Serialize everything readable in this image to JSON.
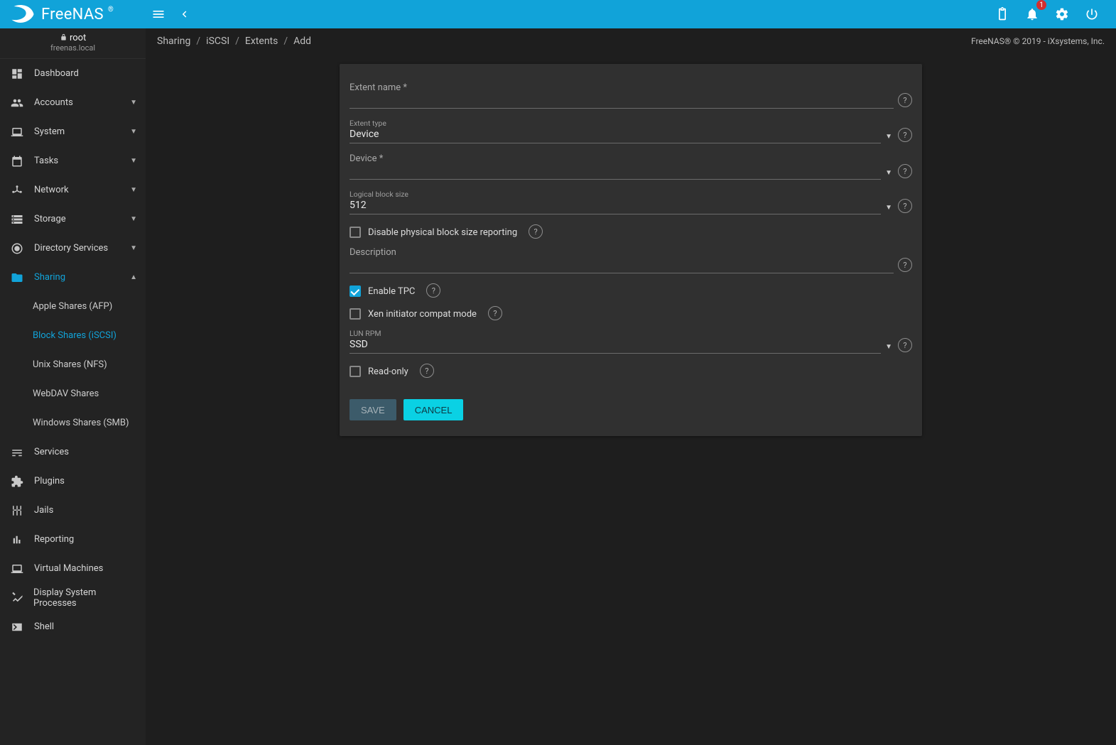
{
  "brand": {
    "name": "FreeNAS"
  },
  "user": {
    "name": "root",
    "host": "freenas.local"
  },
  "topbar": {
    "badge": "1"
  },
  "breadcrumb": [
    "Sharing",
    "iSCSI",
    "Extents",
    "Add"
  ],
  "copyright": "FreeNAS® © 2019 - iXsystems, Inc.",
  "sidebar": {
    "items": [
      {
        "label": "Dashboard",
        "icon": "dashboard",
        "expandable": false
      },
      {
        "label": "Accounts",
        "icon": "people",
        "expandable": true
      },
      {
        "label": "System",
        "icon": "laptop",
        "expandable": true
      },
      {
        "label": "Tasks",
        "icon": "calendar",
        "expandable": true
      },
      {
        "label": "Network",
        "icon": "share",
        "expandable": true
      },
      {
        "label": "Storage",
        "icon": "storage",
        "expandable": true
      },
      {
        "label": "Directory Services",
        "icon": "ds",
        "expandable": true
      },
      {
        "label": "Sharing",
        "icon": "folder",
        "expandable": true,
        "active": true,
        "children": [
          {
            "label": "Apple Shares (AFP)"
          },
          {
            "label": "Block Shares (iSCSI)",
            "active": true
          },
          {
            "label": "Unix Shares (NFS)"
          },
          {
            "label": "WebDAV Shares"
          },
          {
            "label": "Windows Shares (SMB)"
          }
        ]
      },
      {
        "label": "Services",
        "icon": "tune",
        "expandable": false
      },
      {
        "label": "Plugins",
        "icon": "extension",
        "expandable": false
      },
      {
        "label": "Jails",
        "icon": "jail",
        "expandable": false
      },
      {
        "label": "Reporting",
        "icon": "chart",
        "expandable": false
      },
      {
        "label": "Virtual Machines",
        "icon": "laptop",
        "expandable": false
      },
      {
        "label": "Display System Processes",
        "icon": "build",
        "expandable": false
      },
      {
        "label": "Shell",
        "icon": "terminal",
        "expandable": false
      }
    ]
  },
  "form": {
    "extent_name": {
      "label": "Extent name *",
      "value": ""
    },
    "extent_type": {
      "label": "Extent type",
      "value": "Device"
    },
    "device": {
      "label": "Device *",
      "value": ""
    },
    "block_size": {
      "label": "Logical block size",
      "value": "512"
    },
    "disable_phys": {
      "label": "Disable physical block size reporting",
      "checked": false
    },
    "description": {
      "label": "Description",
      "value": ""
    },
    "enable_tpc": {
      "label": "Enable TPC",
      "checked": true
    },
    "xen_compat": {
      "label": "Xen initiator compat mode",
      "checked": false
    },
    "lun_rpm": {
      "label": "LUN RPM",
      "value": "SSD"
    },
    "read_only": {
      "label": "Read-only",
      "checked": false
    },
    "save": "SAVE",
    "cancel": "CANCEL"
  }
}
